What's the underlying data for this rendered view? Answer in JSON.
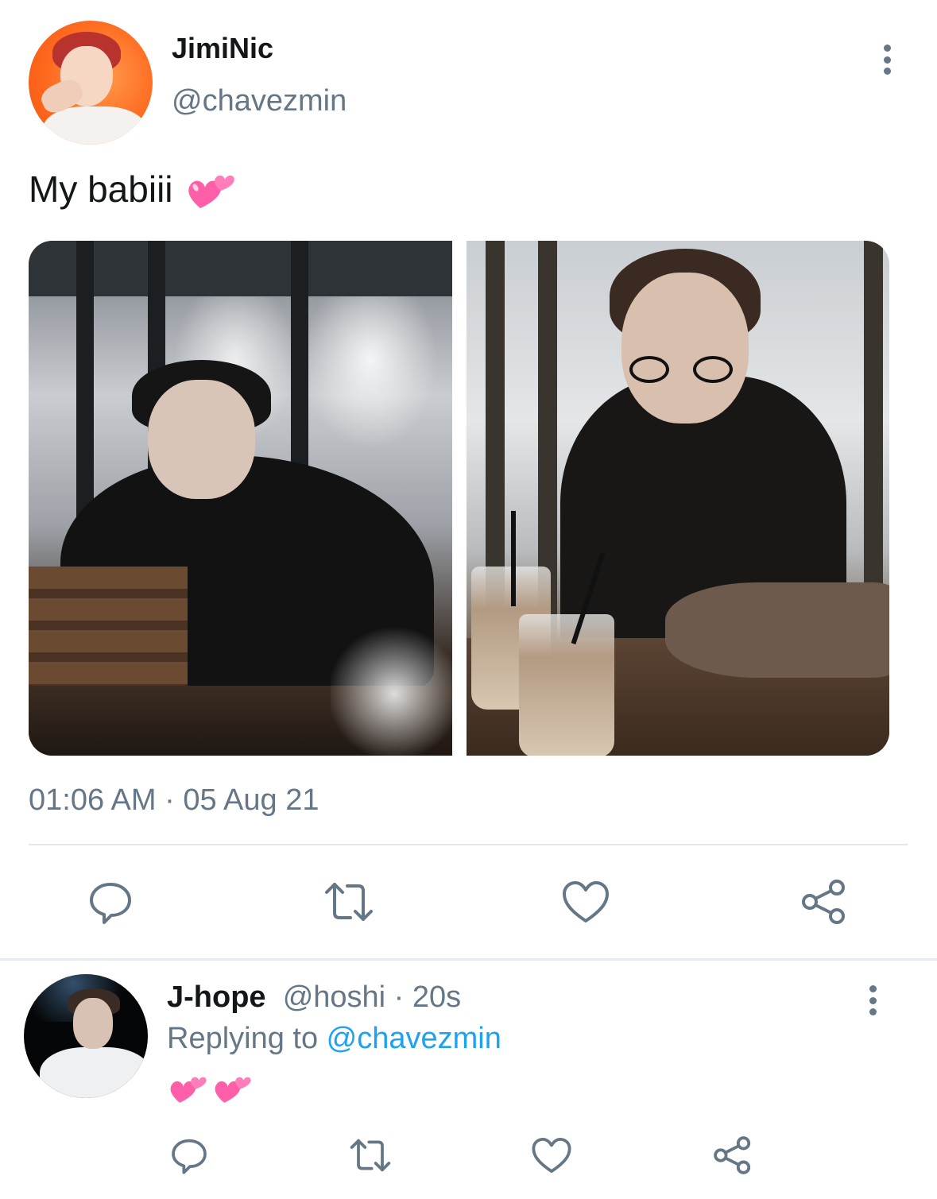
{
  "tweet": {
    "display_name": "JimiNic",
    "handle": "@chavezmin",
    "text": "My babiii",
    "emoji": "two-hearts",
    "timestamp": "01:06 AM · 05 Aug 21",
    "media_count": 2
  },
  "reply": {
    "display_name": "J-hope",
    "handle": "@hoshi",
    "separator": " · ",
    "time_ago": "20s",
    "replying_prefix": "Replying to ",
    "replying_to": "@chavezmin",
    "emojis": [
      "two-hearts",
      "two-hearts"
    ]
  },
  "actions": [
    "reply-icon",
    "retweet-icon",
    "like-icon",
    "share-icon"
  ],
  "colors": {
    "text_primary": "#14171a",
    "text_secondary": "#657786",
    "link": "#1da1f2",
    "icon": "#657786",
    "divider": "#e1e8ed",
    "heart_emoji": "#ff5fa8"
  }
}
